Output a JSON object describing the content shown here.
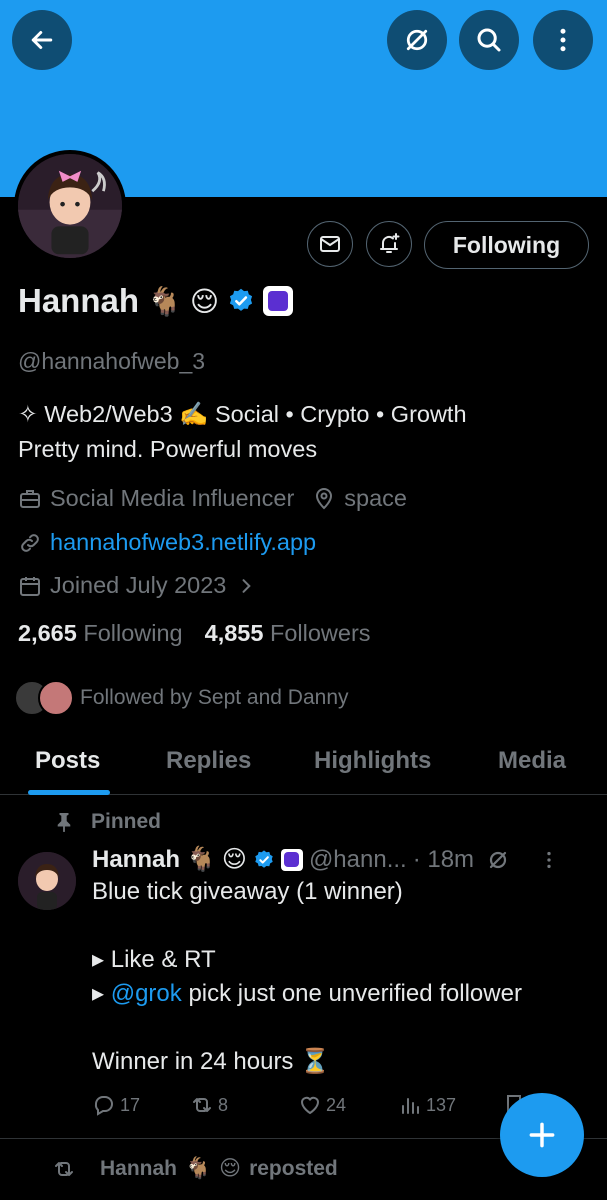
{
  "header": {
    "back_icon": "arrow-left-icon",
    "grok_icon": "grok-icon",
    "search_icon": "search-icon",
    "more_icon": "more-vertical-icon",
    "banner_color": "#1d9bf0"
  },
  "profile": {
    "name": "Hannah",
    "name_emojis": [
      "🐐",
      "😌"
    ],
    "handle": "@hannahofweb_3",
    "bio_line1": "✧ Web2/Web3 ✍️ Social • Crypto • Growth",
    "bio_line2": "Pretty mind. Powerful moves",
    "category": "Social Media Influencer",
    "location": "space",
    "website": "hannahofweb3.netlify.app",
    "joined": "Joined July 2023",
    "following_count": "2,665",
    "following_label": "Following",
    "followers_count": "4,855",
    "followers_label": "Followers",
    "followed_by": "Followed by Sept and Danny"
  },
  "actions": {
    "following_button": "Following"
  },
  "tabs": [
    {
      "label": "Posts",
      "active": true
    },
    {
      "label": "Replies"
    },
    {
      "label": "Highlights"
    },
    {
      "label": "Media"
    }
  ],
  "pinned_post": {
    "pinned_label": "Pinned",
    "author": "Hannah",
    "handle": "@hann...",
    "time": "· 18m",
    "line1": "Blue tick giveaway (1 winner)",
    "line2": "▸ Like & RT",
    "line3_prefix": "▸ ",
    "line3_mention": "@grok",
    "line3_rest": " pick just one unverified follower",
    "line4": "Winner in 24 hours ⏳",
    "replies": "17",
    "reposts": "8",
    "likes": "24",
    "views": "137"
  },
  "next_post": {
    "author": "Hannah",
    "reposted_label": "reposted"
  },
  "colors": {
    "accent": "#1d9bf0",
    "muted": "#71767b",
    "text": "#e7e9ea"
  }
}
